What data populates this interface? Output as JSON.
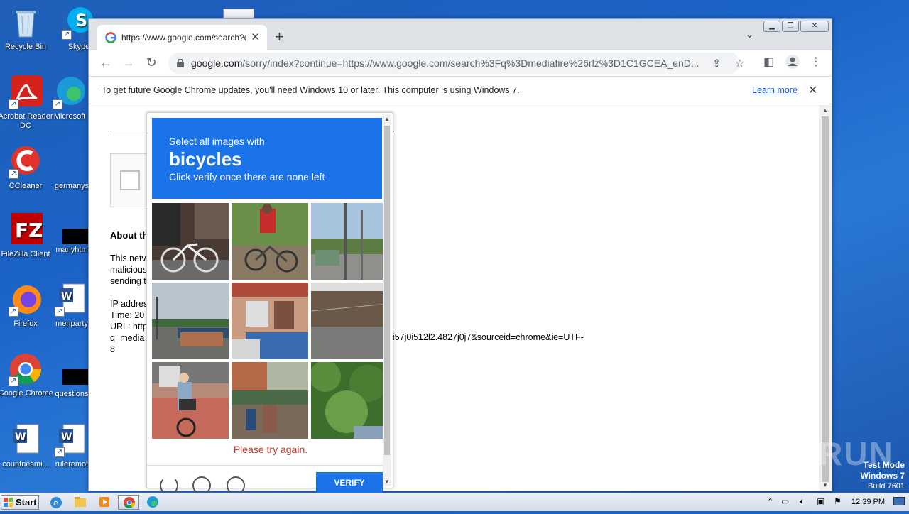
{
  "desktop": {
    "icons": [
      {
        "label": "Recycle Bin"
      },
      {
        "label": "Skype"
      },
      {
        "label": "Acrobat Reader DC"
      },
      {
        "label": "Microsoft"
      },
      {
        "label": "CCleaner"
      },
      {
        "label": "germanys"
      },
      {
        "label": "FileZilla Client"
      },
      {
        "label": "manyhtm"
      },
      {
        "label": "Firefox"
      },
      {
        "label": "menparty"
      },
      {
        "label": "Google Chrome"
      },
      {
        "label": "questions"
      },
      {
        "label": "countriesmi..."
      },
      {
        "label": "ruleremot"
      }
    ],
    "watermark": "ANY RUN",
    "testmode": {
      "line1": "Test Mode",
      "line2": "Windows 7",
      "line3": "Build 7601"
    }
  },
  "browser": {
    "tab_title": "https://www.google.com/search?q=",
    "url_host": "google.com",
    "url_rest": "/sorry/index?continue=https://www.google.com/search%3Fq%3Dmediafire%26rlz%3D1C1GCEA_enD...",
    "infobar": {
      "message": "To get future Google Chrome updates, you'll need Windows 10 or later. This computer is using Windows 7.",
      "link": "Learn more"
    }
  },
  "page": {
    "about_heading": "About th",
    "para1": [
      "This netv",
      "malicious",
      "sending t"
    ],
    "details": [
      "IP addres",
      "Time: 20",
      "URL: http",
      "q=media"
    ],
    "details_last": "8",
    "url_continuation": "69i57j0i512l2.4827j0j7&sourceid=chrome&ie=UTF-"
  },
  "recaptcha": {
    "line1": "Select all images with",
    "keyword": "bicycles",
    "line3": "Click verify once there are none left",
    "error": "Please try again.",
    "verify_label": "VERIFY"
  },
  "taskbar": {
    "start_label": "Start",
    "clock": "12:39 PM"
  }
}
